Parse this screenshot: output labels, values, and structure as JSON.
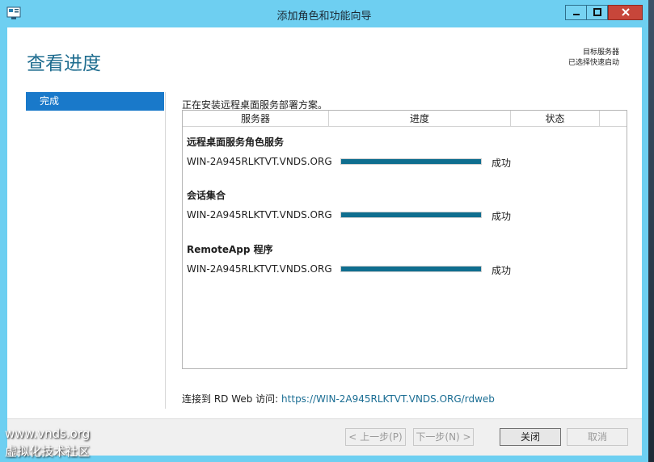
{
  "window": {
    "title": "添加角色和功能向导"
  },
  "page": {
    "title": "查看进度",
    "target_label": "目标服务器",
    "target_value": "已选择快速启动"
  },
  "nav": {
    "items": [
      {
        "label": "完成",
        "selected": true
      }
    ]
  },
  "main": {
    "status_text": "正在安装远程桌面服务部署方案。",
    "table": {
      "headers": [
        "服务器",
        "进度",
        "状态"
      ],
      "groups": [
        {
          "title": "远程桌面服务角色服务",
          "server": "WIN-2A945RLKTVT.VNDS.ORG",
          "progress": 1.0,
          "status": "成功"
        },
        {
          "title": "会话集合",
          "server": "WIN-2A945RLKTVT.VNDS.ORG",
          "progress": 1.0,
          "status": "成功"
        },
        {
          "title": "RemoteApp 程序",
          "server": "WIN-2A945RLKTVT.VNDS.ORG",
          "progress": 1.0,
          "status": "成功"
        }
      ]
    },
    "link_prefix": "连接到 RD Web 访问: ",
    "link_url": "https://WIN-2A945RLKTVT.VNDS.ORG/rdweb"
  },
  "footer": {
    "prev_label": "< 上一步(P)",
    "next_label": "下一步(N) >",
    "close_label": "关闭",
    "cancel_label": "取消"
  },
  "watermark": {
    "line1": "www.vnds.org",
    "line2": "虚拟化技术社区"
  },
  "colors": {
    "titlebar": "#6ecff1",
    "accent": "#1979ca",
    "progress": "#0f6e8f",
    "close_button": "#c7463a"
  }
}
